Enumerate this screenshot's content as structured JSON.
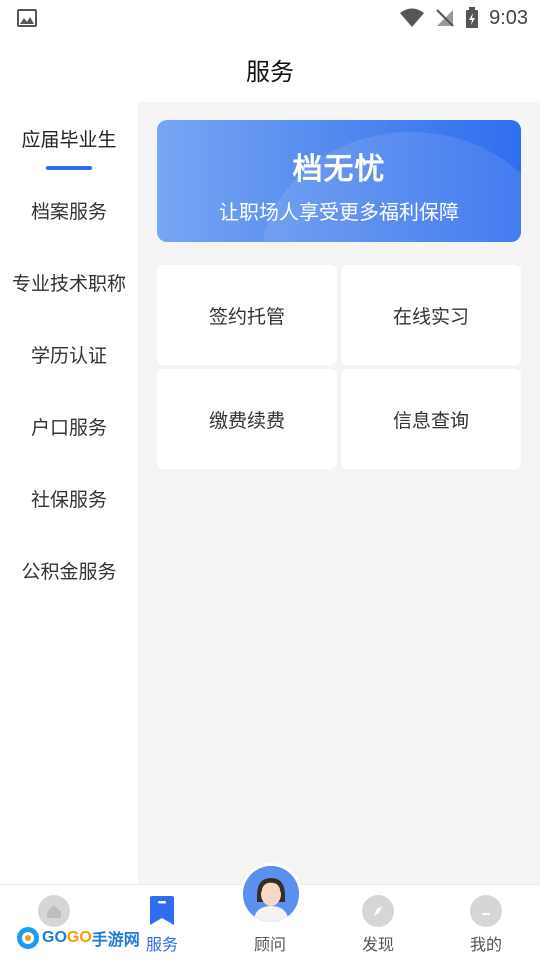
{
  "status_bar": {
    "time": "9:03"
  },
  "page_title": "服务",
  "sidebar": {
    "items": [
      {
        "label": "应届毕业生",
        "active": true
      },
      {
        "label": "档案服务"
      },
      {
        "label": "专业技术职称"
      },
      {
        "label": "学历认证"
      },
      {
        "label": "户口服务"
      },
      {
        "label": "社保服务"
      },
      {
        "label": "公积金服务"
      }
    ]
  },
  "banner": {
    "title": "档无忧",
    "subtitle": "让职场人享受更多福利保障"
  },
  "services": [
    {
      "label": "签约托管"
    },
    {
      "label": "在线实习"
    },
    {
      "label": "缴费续费"
    },
    {
      "label": "信息查询"
    }
  ],
  "tabbar": {
    "tabs": [
      {
        "label": ""
      },
      {
        "label": "服务",
        "active": true
      },
      {
        "label": "顾问"
      },
      {
        "label": "发现"
      },
      {
        "label": "我的"
      }
    ]
  },
  "watermark": {
    "prefix": "GO",
    "brand": "GO",
    "suffix": "手游网"
  },
  "colors": {
    "accent": "#2f6cf0",
    "content_bg": "#f4f4f4"
  }
}
